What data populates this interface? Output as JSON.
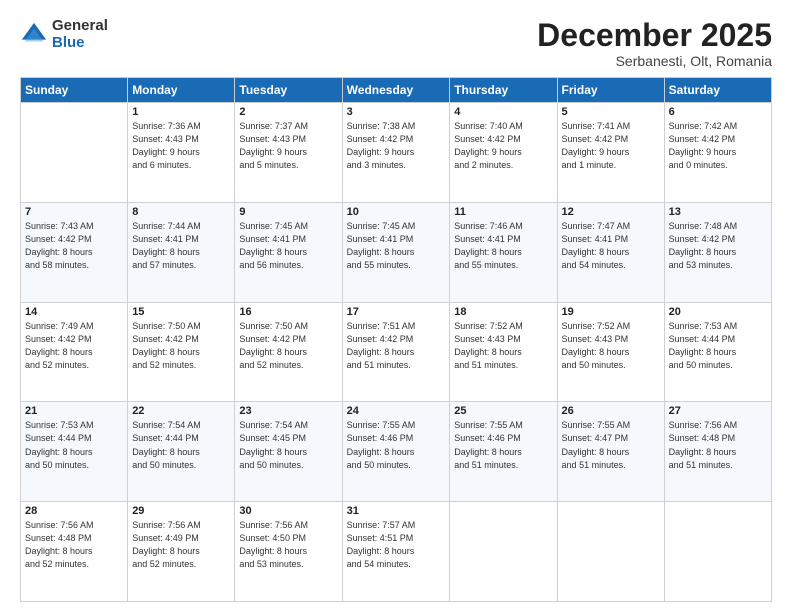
{
  "logo": {
    "general": "General",
    "blue": "Blue"
  },
  "header": {
    "month": "December 2025",
    "location": "Serbanesti, Olt, Romania"
  },
  "weekdays": [
    "Sunday",
    "Monday",
    "Tuesday",
    "Wednesday",
    "Thursday",
    "Friday",
    "Saturday"
  ],
  "weeks": [
    [
      {
        "day": "",
        "info": ""
      },
      {
        "day": "1",
        "info": "Sunrise: 7:36 AM\nSunset: 4:43 PM\nDaylight: 9 hours\nand 6 minutes."
      },
      {
        "day": "2",
        "info": "Sunrise: 7:37 AM\nSunset: 4:43 PM\nDaylight: 9 hours\nand 5 minutes."
      },
      {
        "day": "3",
        "info": "Sunrise: 7:38 AM\nSunset: 4:42 PM\nDaylight: 9 hours\nand 3 minutes."
      },
      {
        "day": "4",
        "info": "Sunrise: 7:40 AM\nSunset: 4:42 PM\nDaylight: 9 hours\nand 2 minutes."
      },
      {
        "day": "5",
        "info": "Sunrise: 7:41 AM\nSunset: 4:42 PM\nDaylight: 9 hours\nand 1 minute."
      },
      {
        "day": "6",
        "info": "Sunrise: 7:42 AM\nSunset: 4:42 PM\nDaylight: 9 hours\nand 0 minutes."
      }
    ],
    [
      {
        "day": "7",
        "info": "Sunrise: 7:43 AM\nSunset: 4:42 PM\nDaylight: 8 hours\nand 58 minutes."
      },
      {
        "day": "8",
        "info": "Sunrise: 7:44 AM\nSunset: 4:41 PM\nDaylight: 8 hours\nand 57 minutes."
      },
      {
        "day": "9",
        "info": "Sunrise: 7:45 AM\nSunset: 4:41 PM\nDaylight: 8 hours\nand 56 minutes."
      },
      {
        "day": "10",
        "info": "Sunrise: 7:45 AM\nSunset: 4:41 PM\nDaylight: 8 hours\nand 55 minutes."
      },
      {
        "day": "11",
        "info": "Sunrise: 7:46 AM\nSunset: 4:41 PM\nDaylight: 8 hours\nand 55 minutes."
      },
      {
        "day": "12",
        "info": "Sunrise: 7:47 AM\nSunset: 4:41 PM\nDaylight: 8 hours\nand 54 minutes."
      },
      {
        "day": "13",
        "info": "Sunrise: 7:48 AM\nSunset: 4:42 PM\nDaylight: 8 hours\nand 53 minutes."
      }
    ],
    [
      {
        "day": "14",
        "info": "Sunrise: 7:49 AM\nSunset: 4:42 PM\nDaylight: 8 hours\nand 52 minutes."
      },
      {
        "day": "15",
        "info": "Sunrise: 7:50 AM\nSunset: 4:42 PM\nDaylight: 8 hours\nand 52 minutes."
      },
      {
        "day": "16",
        "info": "Sunrise: 7:50 AM\nSunset: 4:42 PM\nDaylight: 8 hours\nand 52 minutes."
      },
      {
        "day": "17",
        "info": "Sunrise: 7:51 AM\nSunset: 4:42 PM\nDaylight: 8 hours\nand 51 minutes."
      },
      {
        "day": "18",
        "info": "Sunrise: 7:52 AM\nSunset: 4:43 PM\nDaylight: 8 hours\nand 51 minutes."
      },
      {
        "day": "19",
        "info": "Sunrise: 7:52 AM\nSunset: 4:43 PM\nDaylight: 8 hours\nand 50 minutes."
      },
      {
        "day": "20",
        "info": "Sunrise: 7:53 AM\nSunset: 4:44 PM\nDaylight: 8 hours\nand 50 minutes."
      }
    ],
    [
      {
        "day": "21",
        "info": "Sunrise: 7:53 AM\nSunset: 4:44 PM\nDaylight: 8 hours\nand 50 minutes."
      },
      {
        "day": "22",
        "info": "Sunrise: 7:54 AM\nSunset: 4:44 PM\nDaylight: 8 hours\nand 50 minutes."
      },
      {
        "day": "23",
        "info": "Sunrise: 7:54 AM\nSunset: 4:45 PM\nDaylight: 8 hours\nand 50 minutes."
      },
      {
        "day": "24",
        "info": "Sunrise: 7:55 AM\nSunset: 4:46 PM\nDaylight: 8 hours\nand 50 minutes."
      },
      {
        "day": "25",
        "info": "Sunrise: 7:55 AM\nSunset: 4:46 PM\nDaylight: 8 hours\nand 51 minutes."
      },
      {
        "day": "26",
        "info": "Sunrise: 7:55 AM\nSunset: 4:47 PM\nDaylight: 8 hours\nand 51 minutes."
      },
      {
        "day": "27",
        "info": "Sunrise: 7:56 AM\nSunset: 4:48 PM\nDaylight: 8 hours\nand 51 minutes."
      }
    ],
    [
      {
        "day": "28",
        "info": "Sunrise: 7:56 AM\nSunset: 4:48 PM\nDaylight: 8 hours\nand 52 minutes."
      },
      {
        "day": "29",
        "info": "Sunrise: 7:56 AM\nSunset: 4:49 PM\nDaylight: 8 hours\nand 52 minutes."
      },
      {
        "day": "30",
        "info": "Sunrise: 7:56 AM\nSunset: 4:50 PM\nDaylight: 8 hours\nand 53 minutes."
      },
      {
        "day": "31",
        "info": "Sunrise: 7:57 AM\nSunset: 4:51 PM\nDaylight: 8 hours\nand 54 minutes."
      },
      {
        "day": "",
        "info": ""
      },
      {
        "day": "",
        "info": ""
      },
      {
        "day": "",
        "info": ""
      }
    ]
  ]
}
